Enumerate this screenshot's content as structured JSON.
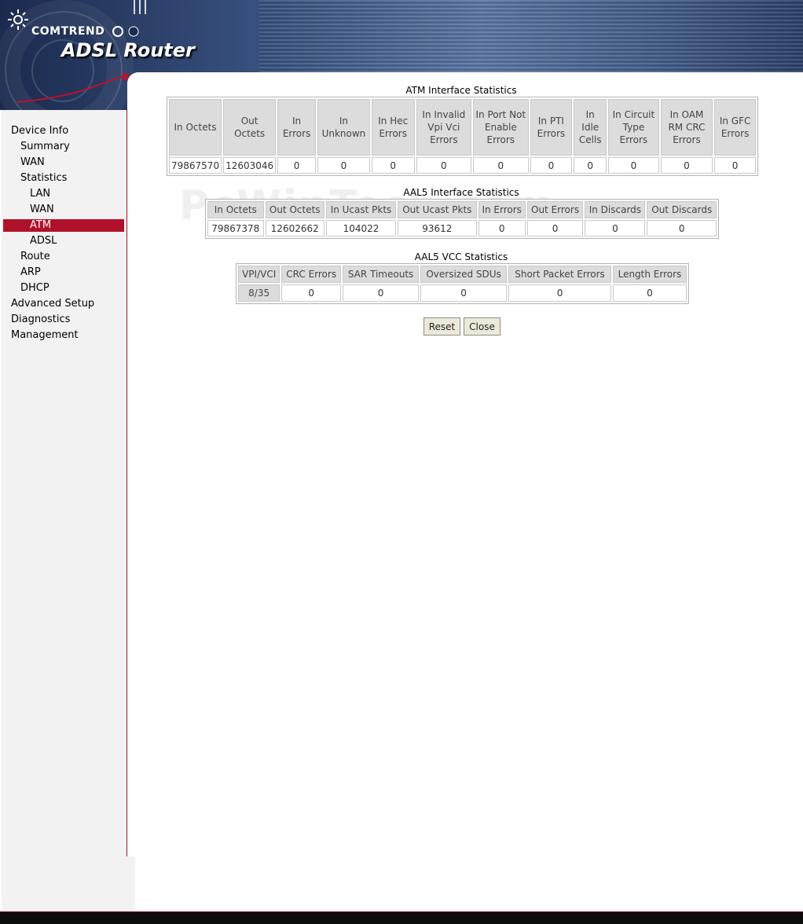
{
  "header": {
    "brand": "COMTREND",
    "product": "ADSL Router"
  },
  "sidebar": {
    "items": [
      {
        "label": "Device Info",
        "level": 1
      },
      {
        "label": "Summary",
        "level": 2
      },
      {
        "label": "WAN",
        "level": 2
      },
      {
        "label": "Statistics",
        "level": 2
      },
      {
        "label": "LAN",
        "level": 3
      },
      {
        "label": "WAN",
        "level": 3
      },
      {
        "label": "ATM",
        "level": 3,
        "active": true
      },
      {
        "label": "ADSL",
        "level": 3
      },
      {
        "label": "Route",
        "level": 2
      },
      {
        "label": "ARP",
        "level": 2
      },
      {
        "label": "DHCP",
        "level": 2
      },
      {
        "label": "Advanced Setup",
        "level": 1
      },
      {
        "label": "Diagnostics",
        "level": 1
      },
      {
        "label": "Management",
        "level": 1
      }
    ],
    "active_color": "#b0112a"
  },
  "atm": {
    "title": "ATM Interface Statistics",
    "headers": [
      "In Octets",
      "Out Octets",
      "In Errors",
      "In Unknown",
      "In Hec Errors",
      "In Invalid Vpi Vci Errors",
      "In Port Not Enable Errors",
      "In PTI Errors",
      "In Idle Cells",
      "In Circuit Type Errors",
      "In OAM RM CRC Errors",
      "In GFC Errors"
    ],
    "values": [
      "79867570",
      "12603046",
      "0",
      "0",
      "0",
      "0",
      "0",
      "0",
      "0",
      "0",
      "0",
      "0"
    ]
  },
  "aal5": {
    "title": "AAL5 Interface Statistics",
    "headers": [
      "In Octets",
      "Out Octets",
      "In Ucast Pkts",
      "Out Ucast Pkts",
      "In Errors",
      "Out Errors",
      "In Discards",
      "Out Discards"
    ],
    "values": [
      "79867378",
      "12602662",
      "104022",
      "93612",
      "0",
      "0",
      "0",
      "0"
    ]
  },
  "vcc": {
    "title": "AAL5 VCC Statistics",
    "headers": [
      "VPI/VCI",
      "CRC Errors",
      "SAR Timeouts",
      "Oversized SDUs",
      "Short Packet Errors",
      "Length Errors"
    ],
    "values": [
      "8/35",
      "0",
      "0",
      "0",
      "0",
      "0"
    ]
  },
  "buttons": {
    "reset": "Reset",
    "close": "Close"
  },
  "watermark": "PcWinTech.com"
}
